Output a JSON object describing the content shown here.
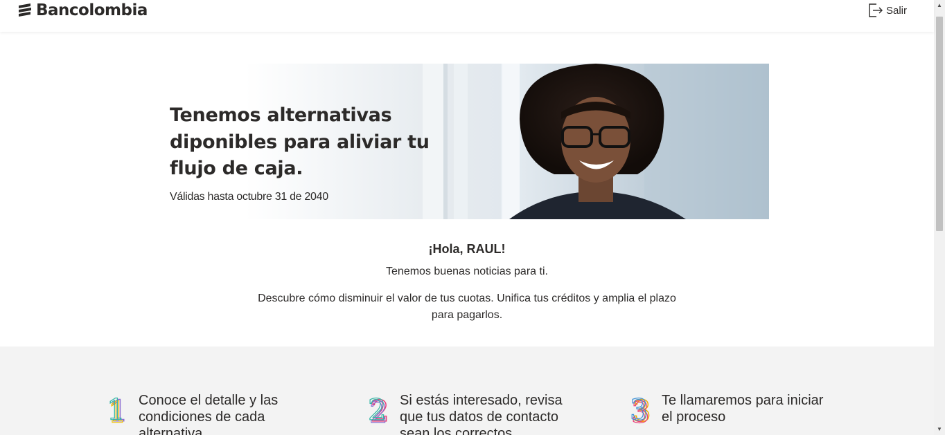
{
  "header": {
    "brand": "Bancolombia",
    "logout_label": "Salir"
  },
  "banner": {
    "title": "Tenemos alternativas diponibles para aliviar tu flujo de caja.",
    "subtitle": "Válidas hasta octubre 31 de 2040"
  },
  "intro": {
    "greeting": "¡Hola, RAUL!",
    "subline": "Tenemos buenas noticias para ti.",
    "description": "Descubre cómo disminuir el valor de tus cuotas. Unifica tus créditos y amplia el plazo para pagarlos."
  },
  "steps": [
    {
      "number": "1",
      "text": "Conoce el detalle y las condiciones de cada alternativa"
    },
    {
      "number": "2",
      "text": "Si estás interesado, revisa que tus datos de contacto sean los correctos"
    },
    {
      "number": "3",
      "text": "Te llamaremos para iniciar el proceso"
    }
  ],
  "colors": {
    "text": "#2c2a29",
    "steps_background": "#f3f3f3",
    "header_background": "#ffffff"
  }
}
